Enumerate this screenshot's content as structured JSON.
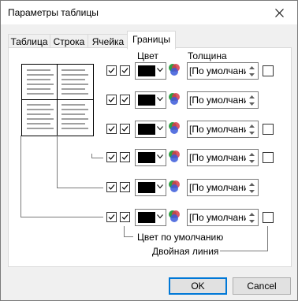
{
  "window": {
    "title": "Параметры таблицы"
  },
  "tabs": [
    {
      "label": "Таблица"
    },
    {
      "label": "Строка"
    },
    {
      "label": "Ячейка"
    },
    {
      "label": "Границы"
    }
  ],
  "headers": {
    "color": "Цвет",
    "thickness": "Толщина"
  },
  "rows": [
    {
      "border": "top",
      "checked_a": true,
      "checked_b": true,
      "color": "#000000",
      "thickness": "[По умолчанию]",
      "double_line": false
    },
    {
      "border": "inner-horizontal",
      "checked_a": true,
      "checked_b": true,
      "color": "#000000",
      "thickness": "[По умолчанию]",
      "double_line": null
    },
    {
      "border": "bottom",
      "checked_a": true,
      "checked_b": true,
      "color": "#000000",
      "thickness": "[По умолчанию]",
      "double_line": false
    },
    {
      "border": "right",
      "checked_a": true,
      "checked_b": true,
      "color": "#000000",
      "thickness": "[По умолчанию]",
      "double_line": false
    },
    {
      "border": "inner-vertical",
      "checked_a": true,
      "checked_b": true,
      "color": "#000000",
      "thickness": "[По умолчанию]",
      "double_line": null
    },
    {
      "border": "left",
      "checked_a": true,
      "checked_b": true,
      "color": "#000000",
      "thickness": "[По умолчанию]",
      "double_line": false
    }
  ],
  "notes": {
    "default_color": "Цвет по умолчанию",
    "double_line": "Двойная линия"
  },
  "buttons": {
    "ok": "OK",
    "cancel": "Cancel"
  },
  "icons": {
    "close": "close-icon",
    "color_dropdown": "chevron-down-icon",
    "color_picker": "color-wheel-icon",
    "spin": "spin-arrows-icon"
  }
}
